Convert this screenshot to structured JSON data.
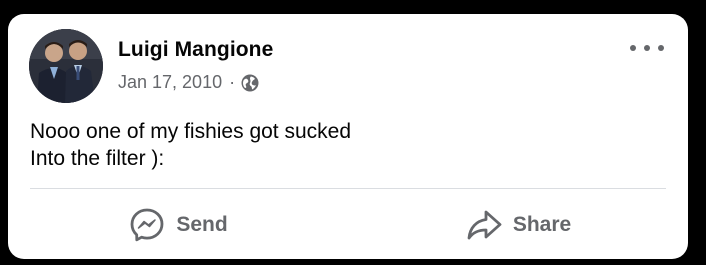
{
  "post": {
    "author": "Luigi Mangione",
    "date": "Jan 17, 2010",
    "separator": "·",
    "privacy_icon": "globe-icon",
    "more_icon": "more-options-icon",
    "text_lines": [
      "Nooo one of my fishies got sucked",
      "Into the filter ):"
    ]
  },
  "actions": {
    "send": {
      "label": "Send",
      "icon": "messenger-icon"
    },
    "share": {
      "label": "Share",
      "icon": "share-arrow-icon"
    }
  },
  "colors": {
    "background": "#000000",
    "card": "#ffffff",
    "primary_text": "#050505",
    "secondary_text": "#65676b",
    "divider": "#dadde1"
  }
}
